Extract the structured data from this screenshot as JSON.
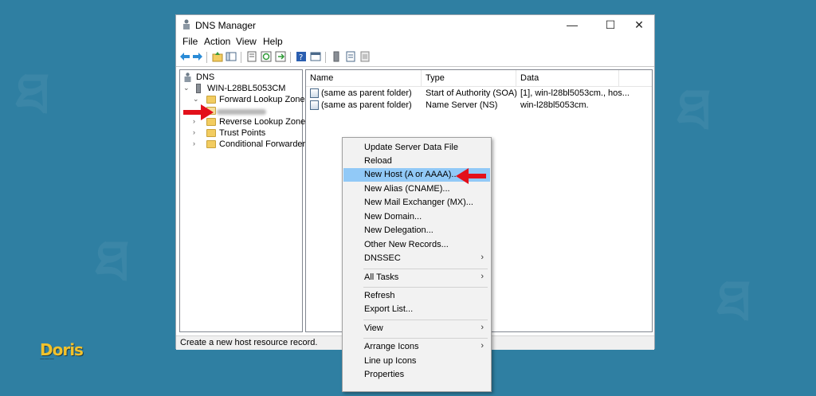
{
  "window": {
    "title": "DNS Manager",
    "controls": {
      "minimize": "—",
      "maximize": "☐",
      "close": "✕"
    }
  },
  "menu": {
    "items": [
      "File",
      "Action",
      "View",
      "Help"
    ]
  },
  "tree": {
    "root": "DNS",
    "server": "WIN-L28BL5053CM",
    "forward_zones": "Forward Lookup Zones",
    "reverse_zones": "Reverse Lookup Zones",
    "trust_points": "Trust Points",
    "conditional_forwarders": "Conditional Forwarders"
  },
  "list": {
    "columns": [
      "Name",
      "Type",
      "Data"
    ],
    "rows": [
      {
        "name": "(same as parent folder)",
        "type": "Start of Authority (SOA)",
        "data": "[1], win-l28bl5053cm., hos..."
      },
      {
        "name": "(same as parent folder)",
        "type": "Name Server (NS)",
        "data": "win-l28bl5053cm."
      }
    ]
  },
  "context_menu": {
    "items": [
      {
        "label": "Update Server Data File"
      },
      {
        "label": "Reload"
      },
      {
        "label": "New Host (A or AAAA)...",
        "highlighted": true
      },
      {
        "label": "New Alias (CNAME)..."
      },
      {
        "label": "New Mail Exchanger (MX)..."
      },
      {
        "label": "New Domain..."
      },
      {
        "label": "New Delegation..."
      },
      {
        "label": "Other New Records..."
      },
      {
        "label": "DNSSEC",
        "submenu": true
      },
      {
        "label": "All Tasks",
        "submenu": true
      },
      {
        "label": "Refresh"
      },
      {
        "label": "Export List..."
      },
      {
        "label": "View",
        "submenu": true
      },
      {
        "label": "Arrange Icons",
        "submenu": true
      },
      {
        "label": "Line up Icons"
      },
      {
        "label": "Properties"
      }
    ],
    "submenu_arrow": "›"
  },
  "status_bar": {
    "text": "Create a new host resource record."
  },
  "tree_glyphs": {
    "expanded": "⌄",
    "collapsed": "›"
  },
  "colors": {
    "highlight": "#91c9f7",
    "annotation_arrow": "#e3101a",
    "background": "#2f7fa2"
  }
}
